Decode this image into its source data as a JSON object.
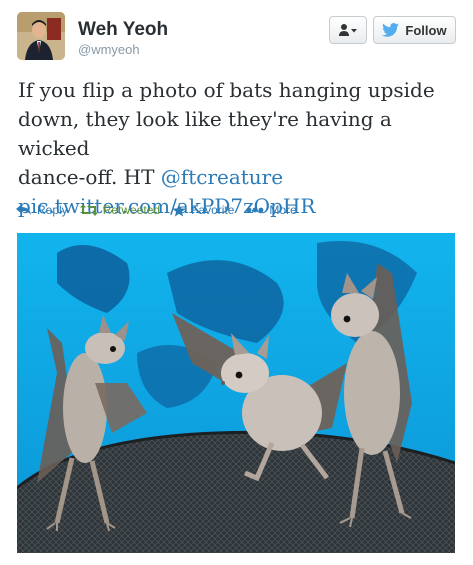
{
  "user": {
    "name": "Weh Yeoh",
    "handle": "@wmyeoh"
  },
  "buttons": {
    "follow_label": "Follow"
  },
  "tweet": {
    "text_lines": [
      "If you flip a photo of bats hanging upside",
      "down, they look like they're having a wicked"
    ],
    "text_line3_prefix": "dance-off. HT ",
    "mention": "@ftcreature",
    "pic_link": "pic.twitter.com/akPD7zOpHR"
  },
  "actions": [
    {
      "label": "Reply",
      "icon": "reply-icon"
    },
    {
      "label": "Retweeted",
      "icon": "retweet-icon"
    },
    {
      "label": "Favorite",
      "icon": "star-icon"
    },
    {
      "label": "More",
      "icon": "more-dots-icon"
    }
  ],
  "colors": {
    "link": "#2b7bb9",
    "retweeted": "#5c913b",
    "photo_background": "#0aa9e6"
  }
}
